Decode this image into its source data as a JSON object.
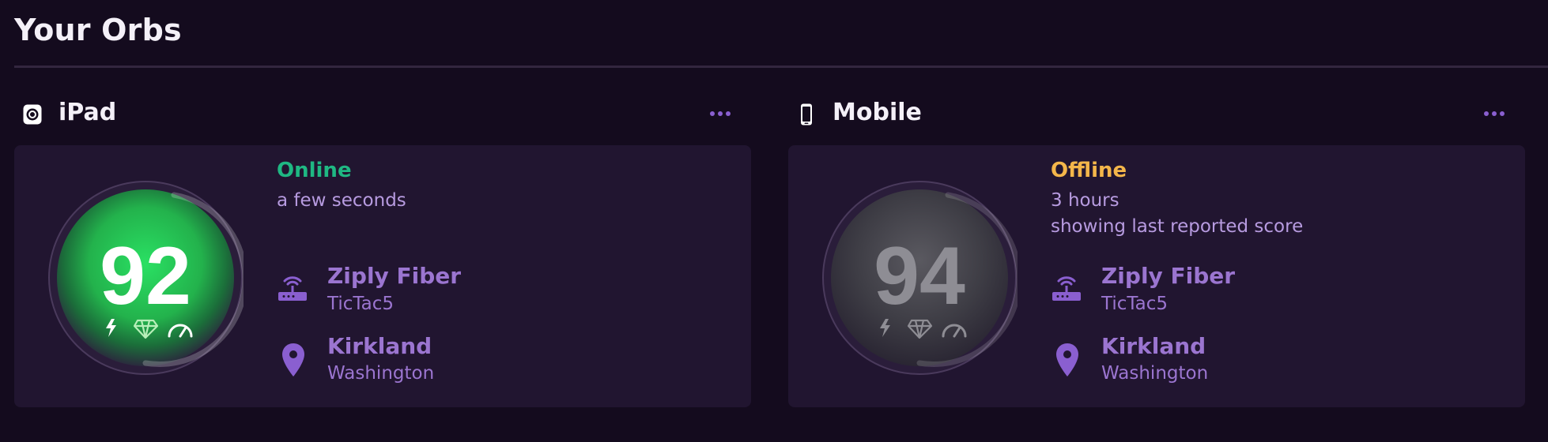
{
  "page": {
    "title": "Your Orbs"
  },
  "orbs": [
    {
      "device_name": "iPad",
      "device_icon": "ipad-orb-icon",
      "more_icon": "more-dots-icon",
      "status": "Online",
      "status_color": "#1fb883",
      "time_ago": "a few seconds",
      "note": "",
      "score": "92",
      "isp_name": "Ziply Fiber",
      "network_name": "TicTac5",
      "city": "Kirkland",
      "region": "Washington",
      "orb_color": "#2fb152"
    },
    {
      "device_name": "Mobile",
      "device_icon": "smartphone-icon",
      "more_icon": "more-dots-icon",
      "status": "Offline",
      "status_color": "#f4b64a",
      "time_ago": "3 hours",
      "note": "showing last reported score",
      "score": "94",
      "isp_name": "Ziply Fiber",
      "network_name": "TicTac5",
      "city": "Kirkland",
      "region": "Washington",
      "orb_color": "#4b4a52"
    }
  ],
  "accent_color": "#8a5fd0"
}
